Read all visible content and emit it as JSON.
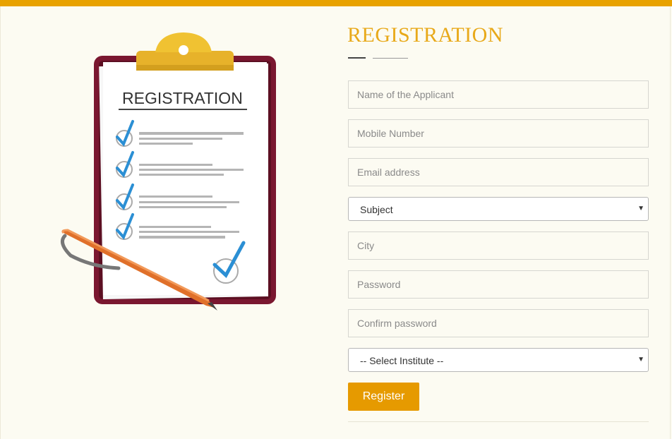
{
  "form": {
    "title": "REGISTRATION",
    "fields": {
      "name": {
        "placeholder": "Name of the Applicant"
      },
      "mobile": {
        "placeholder": "Mobile Number"
      },
      "email": {
        "placeholder": "Email address"
      },
      "subject": {
        "selected": "Subject"
      },
      "city": {
        "placeholder": "City"
      },
      "password": {
        "placeholder": "Password"
      },
      "confirm": {
        "placeholder": "Confirm password"
      },
      "institute": {
        "selected": "-- Select Institute --"
      }
    },
    "register_label": "Register"
  },
  "illustration": {
    "heading": "REGISTRATION"
  },
  "icons": {
    "dropdown": "chevron-down-icon",
    "check": "checkmark-icon",
    "pen": "pen-icon",
    "clipboard": "clipboard-icon"
  },
  "colors": {
    "accent": "#e69a00",
    "title": "#e8a91a",
    "topbar": "#e8a200",
    "check": "#2b8fd4",
    "clipboard": "#7a1730",
    "pen": "#e0702a"
  }
}
